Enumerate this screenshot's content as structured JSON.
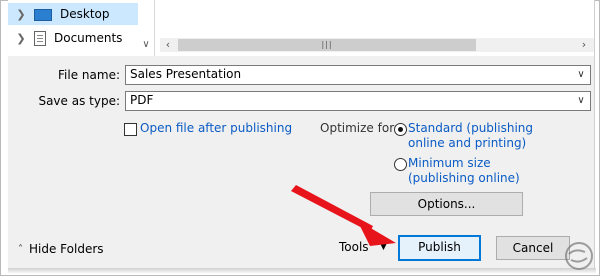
{
  "tree": {
    "items": [
      {
        "label": "Desktop",
        "icon": "desktop-icon",
        "selected": true
      },
      {
        "label": "Documents",
        "icon": "documents-icon",
        "selected": false
      }
    ]
  },
  "form": {
    "file_name_label": "File name:",
    "file_name_value": "Sales Presentation",
    "save_type_label": "Save as type:",
    "save_type_value": "PDF"
  },
  "options": {
    "open_after_label": "Open file after publishing",
    "open_after_checked": false,
    "optimize_label": "Optimize for:",
    "standard_line1": "Standard (publishing",
    "standard_line2": "online and printing)",
    "standard_selected": true,
    "minimum_line1": "Minimum size",
    "minimum_line2": "(publishing online)",
    "minimum_selected": false,
    "options_button": "Options..."
  },
  "footer": {
    "hide_folders": "Hide Folders",
    "tools": "Tools",
    "publish": "Publish",
    "cancel": "Cancel"
  },
  "colors": {
    "accent": "#0078d7",
    "link_blue": "#0a5bc4",
    "annotation_arrow": "#e8141c"
  }
}
